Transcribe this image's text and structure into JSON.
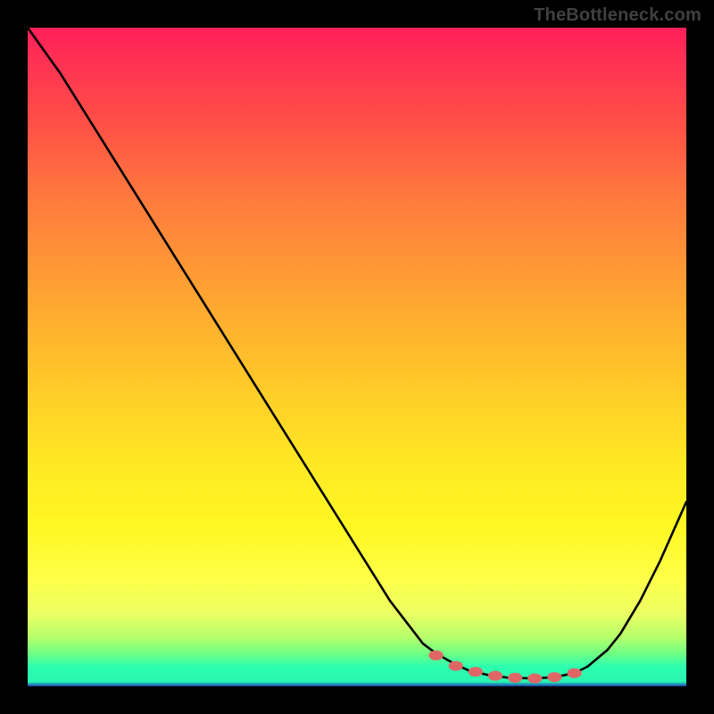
{
  "watermark": "TheBottleneck.com",
  "chart_data": {
    "type": "line",
    "title": "",
    "xlabel": "",
    "ylabel": "",
    "xlim": [
      0,
      100
    ],
    "ylim": [
      0,
      100
    ],
    "curve": {
      "x": [
        0,
        5,
        10,
        15,
        20,
        25,
        30,
        35,
        40,
        45,
        50,
        55,
        60,
        62,
        65,
        67,
        70,
        73,
        77,
        80,
        83,
        85,
        88,
        90,
        93,
        96,
        100
      ],
      "y": [
        100,
        93,
        85,
        77,
        69,
        61,
        53,
        45,
        37,
        29,
        21,
        13,
        6.5,
        5,
        3.3,
        2.4,
        1.7,
        1.3,
        1.2,
        1.4,
        2,
        3,
        5.5,
        8,
        13,
        19,
        28
      ]
    },
    "optimum_markers": {
      "x": [
        62,
        65,
        68,
        71,
        74,
        77,
        80,
        83
      ],
      "y": [
        4.7,
        3.1,
        2.2,
        1.6,
        1.3,
        1.2,
        1.4,
        2.0
      ]
    },
    "gradient_colors": {
      "top": "#ff1f58",
      "mid": "#ffff4a",
      "bottom_green": "#2dffb0",
      "bottom_blue": "#1a3db3"
    }
  }
}
